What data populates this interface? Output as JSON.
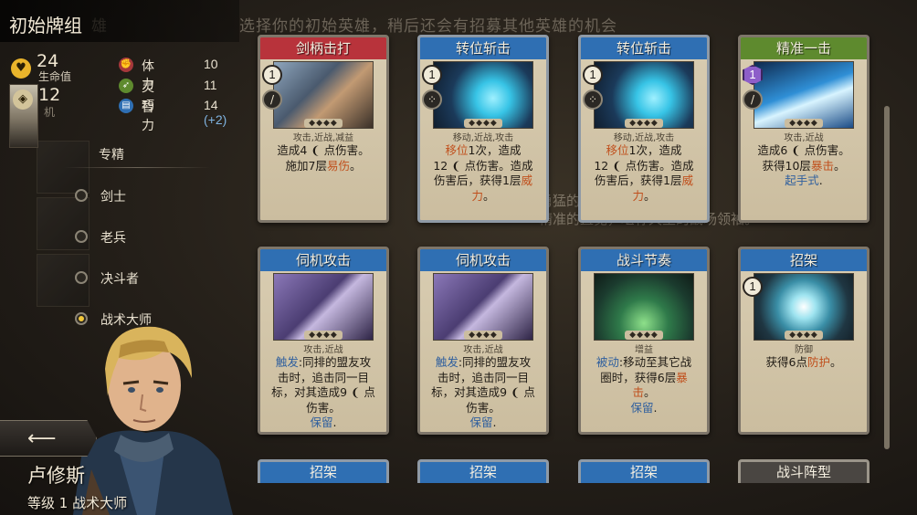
{
  "deck_title": "初始牌组",
  "hero_stats": {
    "hp": "24",
    "hp_label": "生命值",
    "second_val": "12",
    "second_label": "机"
  },
  "attributes": [
    {
      "name": "体力",
      "value": "10",
      "bonus": ""
    },
    {
      "name": "灵巧",
      "value": "11",
      "bonus": ""
    },
    {
      "name": "智力",
      "value": "14",
      "bonus": "(+2)"
    }
  ],
  "specialization": {
    "label": "专精",
    "options": [
      {
        "name": "剑士",
        "selected": false
      },
      {
        "name": "老兵",
        "selected": false
      },
      {
        "name": "决斗者",
        "selected": false
      },
      {
        "name": "战术大师",
        "selected": true
      }
    ]
  },
  "background": {
    "header": "选择你的初始英雄，稍后还会有招募其他英雄的机会",
    "tag": "雄",
    "lore": [
      "勇猛的",
      "精准的直觉，堪称天生的战场领袖。"
    ]
  },
  "hero": {
    "name": "卢修斯",
    "level_text": "等级 1 战术大师",
    "back_glyph": "⟵"
  },
  "cards": [
    {
      "title": "剑柄击打",
      "header_color": "#b8333b",
      "cost": "1",
      "cost_style": "normal",
      "icon": "sword",
      "type": "攻击,近战,减益",
      "pips": "◆◆◆◆",
      "lines": [
        [
          {
            "t": "造成4 ❨ 点伤害。",
            "c": ""
          }
        ],
        [
          {
            "t": "施加7层",
            "c": ""
          },
          {
            "t": "易伤",
            "c": "#c0501d"
          },
          {
            "t": "。",
            "c": ""
          }
        ]
      ]
    },
    {
      "title": "转位斩击",
      "header_color": "#2f6fb3",
      "cost": "1",
      "cost_style": "normal",
      "icon": "dots",
      "type": "移动,近战,攻击",
      "pips": "◆◆◆◆",
      "lines": [
        [
          {
            "t": "移位",
            "c": "#c0501d"
          },
          {
            "t": "1次，造成",
            "c": ""
          }
        ],
        [
          {
            "t": "12 ❨ 点伤害。造成",
            "c": ""
          }
        ],
        [
          {
            "t": "伤害后，获得1层",
            "c": ""
          },
          {
            "t": "威",
            "c": "#c0501d"
          }
        ],
        [
          {
            "t": "力",
            "c": "#c0501d"
          },
          {
            "t": "。",
            "c": ""
          }
        ]
      ]
    },
    {
      "title": "转位斩击",
      "header_color": "#2f6fb3",
      "cost": "1",
      "cost_style": "normal",
      "icon": "dots",
      "type": "移动,近战,攻击",
      "pips": "◆◆◆◆",
      "lines": [
        [
          {
            "t": "移位",
            "c": "#c0501d"
          },
          {
            "t": "1次，造成",
            "c": ""
          }
        ],
        [
          {
            "t": "12 ❨ 点伤害。造成",
            "c": ""
          }
        ],
        [
          {
            "t": "伤害后，获得1层",
            "c": ""
          },
          {
            "t": "威",
            "c": "#c0501d"
          }
        ],
        [
          {
            "t": "力",
            "c": "#c0501d"
          },
          {
            "t": "。",
            "c": ""
          }
        ]
      ]
    },
    {
      "title": "精准一击",
      "header_color": "#5e8a2e",
      "cost": "1",
      "cost_style": "purple",
      "icon": "sword",
      "type": "攻击,近战",
      "pips": "◆◆◆◆",
      "lines": [
        [
          {
            "t": "造成6 ❨ 点伤害。",
            "c": ""
          }
        ],
        [
          {
            "t": "获得10层",
            "c": ""
          },
          {
            "t": "暴击",
            "c": "#c0501d"
          },
          {
            "t": "。",
            "c": ""
          }
        ],
        [
          {
            "t": "起手式",
            "c": "#2f5f9e"
          },
          {
            "t": ".",
            "c": ""
          }
        ]
      ]
    },
    {
      "title": "伺机攻击",
      "header_color": "#2f6fb3",
      "cost": "",
      "cost_style": "none",
      "icon": "",
      "type": "攻击,近战",
      "pips": "◆◆◆◆",
      "lines": [
        [
          {
            "t": "触发",
            "c": "#2f5f9e"
          },
          {
            "t": ":同排的盟友攻",
            "c": ""
          }
        ],
        [
          {
            "t": "击时，追击同一目",
            "c": ""
          }
        ],
        [
          {
            "t": "标，对其造成9 ❨ 点",
            "c": ""
          }
        ],
        [
          {
            "t": "伤害。",
            "c": ""
          }
        ],
        [
          {
            "t": "保留",
            "c": "#2f5f9e"
          },
          {
            "t": ".",
            "c": ""
          }
        ]
      ]
    },
    {
      "title": "伺机攻击",
      "header_color": "#2f6fb3",
      "cost": "",
      "cost_style": "none",
      "icon": "",
      "type": "攻击,近战",
      "pips": "◆◆◆◆",
      "lines": [
        [
          {
            "t": "触发",
            "c": "#2f5f9e"
          },
          {
            "t": ":同排的盟友攻",
            "c": ""
          }
        ],
        [
          {
            "t": "击时，追击同一目",
            "c": ""
          }
        ],
        [
          {
            "t": "标，对其造成9 ❨ 点",
            "c": ""
          }
        ],
        [
          {
            "t": "伤害。",
            "c": ""
          }
        ],
        [
          {
            "t": "保留",
            "c": "#2f5f9e"
          },
          {
            "t": ".",
            "c": ""
          }
        ]
      ]
    },
    {
      "title": "战斗节奏",
      "header_color": "#2f6fb3",
      "cost": "",
      "cost_style": "none",
      "icon": "",
      "type": "增益",
      "pips": "◆◆◆◆",
      "lines": [
        [
          {
            "t": "被动",
            "c": "#2f5f9e"
          },
          {
            "t": ":移动至其它战",
            "c": ""
          }
        ],
        [
          {
            "t": "圈时，获得6层",
            "c": ""
          },
          {
            "t": "暴",
            "c": "#c0501d"
          }
        ],
        [
          {
            "t": "击",
            "c": "#c0501d"
          },
          {
            "t": "。",
            "c": ""
          }
        ],
        [
          {
            "t": "保留",
            "c": "#2f5f9e"
          },
          {
            "t": ".",
            "c": ""
          }
        ]
      ]
    },
    {
      "title": "招架",
      "header_color": "#2f6fb3",
      "cost": "1",
      "cost_style": "normal",
      "icon": "",
      "type": "防御",
      "pips": "◆◆◆◆",
      "lines": [
        [
          {
            "t": "获得6点",
            "c": ""
          },
          {
            "t": "防护",
            "c": "#c0501d"
          },
          {
            "t": "。",
            "c": ""
          }
        ]
      ]
    }
  ],
  "bottom_cards": [
    {
      "title": "招架",
      "header_color": "#2f6fb3"
    },
    {
      "title": "招架",
      "header_color": "#2f6fb3"
    },
    {
      "title": "招架",
      "header_color": "#2f6fb3"
    },
    {
      "title": "战斗阵型",
      "header_color": "#4a4642"
    }
  ]
}
